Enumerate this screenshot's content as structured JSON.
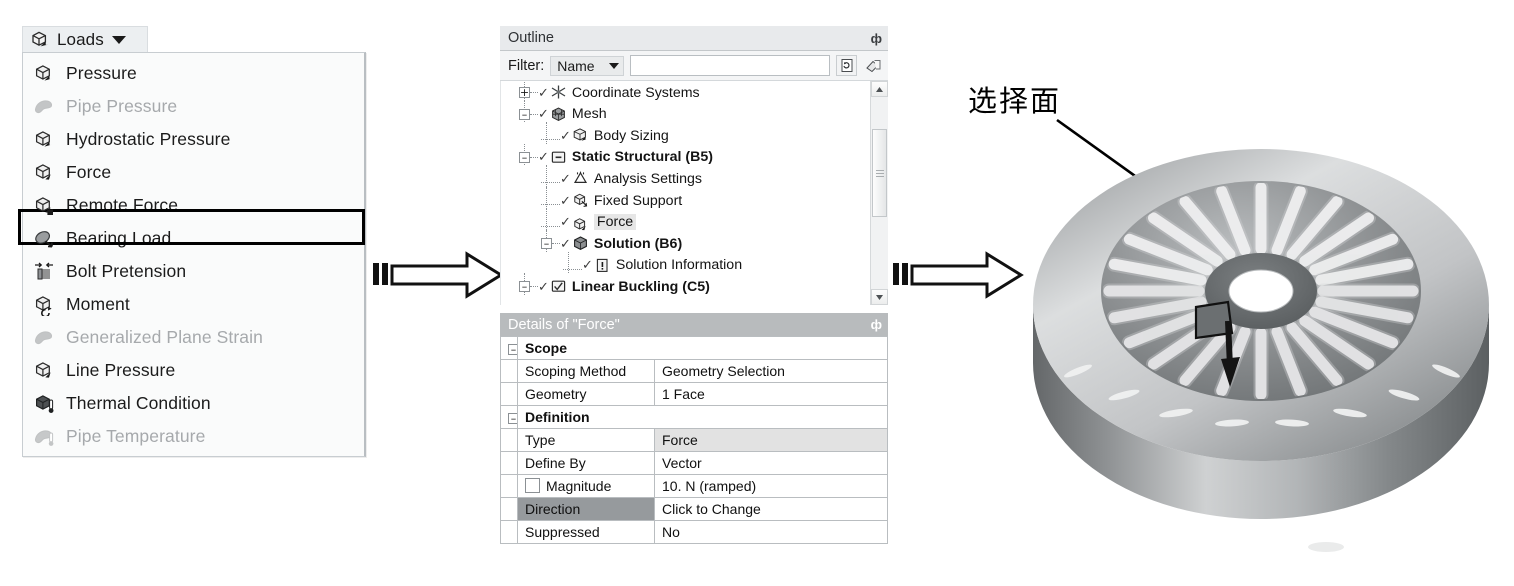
{
  "loads_menu": {
    "header_label": "Loads",
    "header_icon": "cube-arrow-icon",
    "caret_icon": "chevron-down-icon",
    "items": [
      {
        "label": "Pressure",
        "icon": "pressure-icon",
        "disabled": false
      },
      {
        "label": "Pipe Pressure",
        "icon": "pipe-pressure-icon",
        "disabled": true
      },
      {
        "label": "Hydrostatic Pressure",
        "icon": "hydrostatic-pressure-icon",
        "disabled": false
      },
      {
        "label": "Force",
        "icon": "force-icon",
        "disabled": false,
        "highlighted": true
      },
      {
        "label": "Remote Force",
        "icon": "remote-force-icon",
        "disabled": false
      },
      {
        "label": "Bearing Load",
        "icon": "bearing-load-icon",
        "disabled": false
      },
      {
        "label": "Bolt Pretension",
        "icon": "bolt-pretension-icon",
        "disabled": false
      },
      {
        "label": "Moment",
        "icon": "moment-icon",
        "disabled": false
      },
      {
        "label": "Generalized Plane Strain",
        "icon": "plane-strain-icon",
        "disabled": true
      },
      {
        "label": "Line Pressure",
        "icon": "line-pressure-icon",
        "disabled": false
      },
      {
        "label": "Thermal Condition",
        "icon": "thermal-condition-icon",
        "disabled": false
      },
      {
        "label": "Pipe Temperature",
        "icon": "pipe-temperature-icon",
        "disabled": true
      }
    ]
  },
  "outline": {
    "title": "Outline",
    "pin_glyph": "ф",
    "filter": {
      "label": "Filter:",
      "select_value": "Name",
      "input_value": "",
      "input_placeholder": "",
      "refresh_icon": "refresh-page-icon",
      "clear_icon": "eraser-icon"
    },
    "tree": [
      {
        "label": "Coordinate Systems",
        "depth": 1,
        "expander": "+",
        "bold": false,
        "check": true,
        "icon": "coordinate-systems-icon"
      },
      {
        "label": "Mesh",
        "depth": 1,
        "expander": "–",
        "bold": false,
        "check": true,
        "icon": "mesh-icon"
      },
      {
        "label": "Body Sizing",
        "depth": 2,
        "expander": "",
        "bold": false,
        "check": true,
        "icon": "body-sizing-icon"
      },
      {
        "label": "Static Structural (B5)",
        "depth": 1,
        "expander": "–",
        "bold": true,
        "check": true,
        "icon": "static-structural-icon"
      },
      {
        "label": "Analysis Settings",
        "depth": 2,
        "expander": "",
        "bold": false,
        "check": true,
        "icon": "analysis-settings-icon"
      },
      {
        "label": "Fixed Support",
        "depth": 2,
        "expander": "",
        "bold": false,
        "check": true,
        "icon": "fixed-support-icon"
      },
      {
        "label": "Force",
        "depth": 2,
        "expander": "",
        "bold": false,
        "check": true,
        "icon": "force-icon",
        "selected": true
      },
      {
        "label": "Solution (B6)",
        "depth": 2,
        "expander": "–",
        "bold": true,
        "check": true,
        "icon": "solution-icon"
      },
      {
        "label": "Solution Information",
        "depth": 3,
        "expander": "",
        "bold": false,
        "check": true,
        "icon": "solution-information-icon"
      },
      {
        "label": "Linear Buckling (C5)",
        "depth": 1,
        "expander": "–",
        "bold": true,
        "check": true,
        "icon": "linear-buckling-icon"
      }
    ],
    "scrollbar": {
      "up_icon": "scroll-up-icon",
      "down_icon": "scroll-down-icon",
      "thumb_icon": "scroll-thumb-grip"
    }
  },
  "details": {
    "title": "Details of \"Force\"",
    "pin_glyph": "ф",
    "rows": [
      {
        "kind": "group",
        "label": "Scope",
        "expander": "–"
      },
      {
        "kind": "pair",
        "label": "Scoping Method",
        "value": "Geometry Selection"
      },
      {
        "kind": "pair",
        "label": "Geometry",
        "value": "1 Face"
      },
      {
        "kind": "group",
        "label": "Definition",
        "expander": "–"
      },
      {
        "kind": "pair",
        "label": "Type",
        "value": "Force",
        "value_shaded": true
      },
      {
        "kind": "pair",
        "label": "Define By",
        "value": "Vector"
      },
      {
        "kind": "pair",
        "label": "Magnitude",
        "value": "10. N  (ramped)",
        "checkbox": true
      },
      {
        "kind": "pair",
        "label": "Direction",
        "value": "Click to Change",
        "label_selected": true
      },
      {
        "kind": "pair",
        "label": "Suppressed",
        "value": "No"
      }
    ]
  },
  "annotation": {
    "text": "选择面",
    "leader_icon": "leader-arrow-icon"
  },
  "flow_arrows": [
    {
      "name": "flow-arrow-1",
      "icon": "block-arrow-right-icon"
    },
    {
      "name": "flow-arrow-2",
      "icon": "block-arrow-right-icon"
    }
  ],
  "model": {
    "name": "clutch-cover-3d-model",
    "selected_face_marker": "selected-face-patch",
    "force_vector": "force-direction-arrow",
    "colors": {
      "body_light": "#d2d4d5",
      "body_mid": "#8e9193",
      "body_dark": "#5d6163",
      "slot_white": "#ffffff"
    }
  }
}
